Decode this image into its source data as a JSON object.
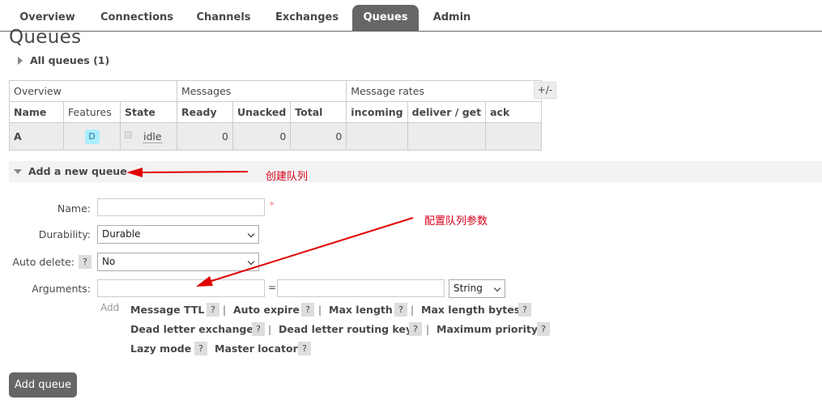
{
  "nav": {
    "tabs": [
      "Overview",
      "Connections",
      "Channels",
      "Exchanges",
      "Queues",
      "Admin"
    ],
    "active": "Queues"
  },
  "page": {
    "title": "Queues",
    "all_queues_label": "All queues (1)"
  },
  "table": {
    "group_headers": [
      "Overview",
      "Messages",
      "Message rates"
    ],
    "toggle_label": "+/-",
    "columns": [
      "Name",
      "Features",
      "State",
      "Ready",
      "Unacked",
      "Total",
      "incoming",
      "deliver / get",
      "ack"
    ],
    "rows": [
      {
        "name": "A",
        "feature": "D",
        "state": "idle",
        "ready": "0",
        "unacked": "0",
        "total": "0",
        "incoming": "",
        "deliver_get": "",
        "ack": ""
      }
    ]
  },
  "add_queue": {
    "section_label": "Add a new queue",
    "name_label": "Name:",
    "name_value": "",
    "required_mark": "*",
    "durability_label": "Durability:",
    "durability_value": "Durable",
    "auto_delete_label": "Auto delete:",
    "auto_delete_value": "No",
    "help_mark": "?",
    "arguments_label": "Arguments:",
    "equals": "=",
    "arg_type_value": "String",
    "add_label": "Add",
    "separator": "|",
    "arg_links": [
      "Message TTL",
      "Auto expire",
      "Max length",
      "Max length bytes",
      "Dead letter exchange",
      "Dead letter routing key",
      "Maximum priority",
      "Lazy mode",
      "Master locator"
    ],
    "submit_label": "Add queue"
  },
  "annotations": {
    "create_queue": "创建队列",
    "config_args": "配置队列参数"
  },
  "colors": {
    "active_tab": "#666666",
    "annotation": "#d9001b",
    "feature_badge": "#aaeeff",
    "row_background": "#ececec"
  }
}
